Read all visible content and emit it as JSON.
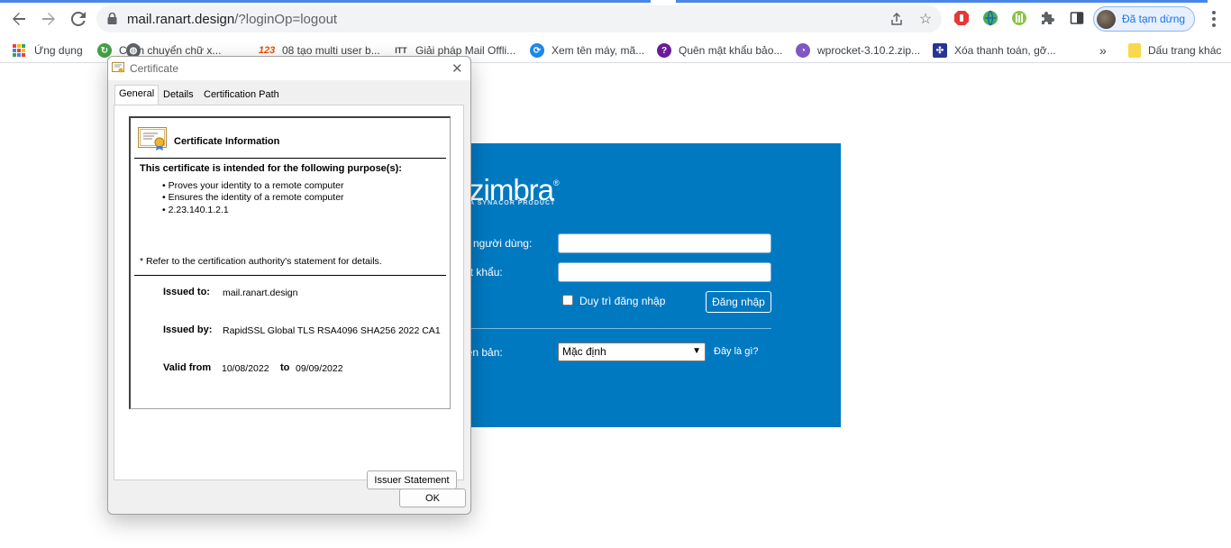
{
  "browser": {
    "url_host": "mail.ranart.design",
    "url_path": "/?loginOp=logout",
    "profile_label": "Đã tạm dừng"
  },
  "bookmarks": {
    "apps": "Ứng dụng",
    "items": [
      "Cách chuyển chữ x...",
      "08 tạo multi user b...",
      "Giải pháp Mail Offli...",
      "Xem tên máy, mã...",
      "Quên mật khẩu bảo...",
      "wprocket-3.10.2.zip...",
      "Xóa thanh toán, gỡ..."
    ],
    "more": "»",
    "other": "Dấu trang khác"
  },
  "zimbra": {
    "logo": "zimbra",
    "tagline": "A SYNACOR PRODUCT",
    "username_label": "n người dùng:",
    "password_label": "ật khẩu:",
    "remember_label": "Duy trì đăng nhập",
    "login_button": "Đăng nhập",
    "version_label": "iên bản:",
    "version_value": "Mặc định",
    "help_link": "Đây là gì?"
  },
  "dialog": {
    "title": "Certificate",
    "tabs": [
      "General",
      "Details",
      "Certification Path"
    ],
    "info_heading": "Certificate Information",
    "purpose_heading": "This certificate is intended for the following purpose(s):",
    "purposes": [
      "• Proves your identity to a remote computer",
      "• Ensures the identity of a remote computer",
      "• 2.23.140.1.2.1"
    ],
    "refer_note": "* Refer to the certification authority's statement for details.",
    "issued_to_label": "Issued to:",
    "issued_to_value": "mail.ranart.design",
    "issued_by_label": "Issued by:",
    "issued_by_value": "RapidSSL Global TLS RSA4096 SHA256 2022 CA1",
    "valid_from_label": "Valid from",
    "valid_from_value": "10/08/2022",
    "valid_to_label": "to",
    "valid_to_value": "09/09/2022",
    "issuer_button": "Issuer Statement",
    "ok_button": "OK"
  }
}
